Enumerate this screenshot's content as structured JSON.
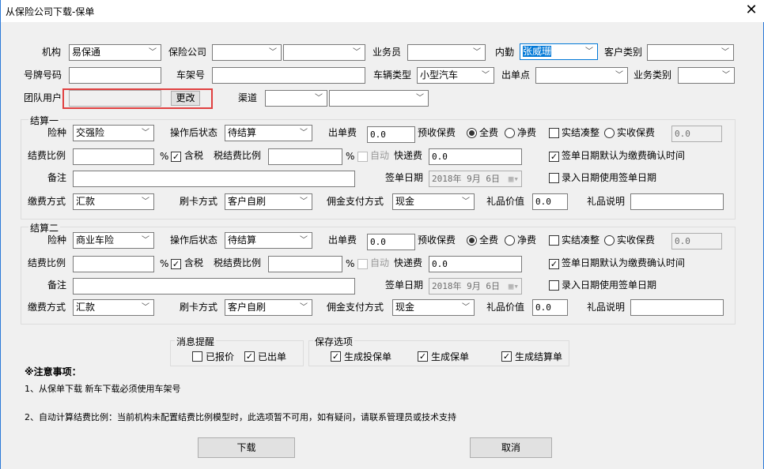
{
  "window": {
    "title": "从保险公司下载-保单",
    "close": "✕"
  },
  "top": {
    "org_label": "机构",
    "org_value": "易保通",
    "insurer_label": "保险公司",
    "insurer_value": "",
    "insurer_value2": "",
    "salesman_label": "业务员",
    "salesman_value": "",
    "internal_label": "内勤",
    "internal_value": "张威珊",
    "customer_type_label": "客户类别",
    "customer_type_value": "",
    "plate_label": "号牌号码",
    "plate_value": "",
    "vin_label": "车架号",
    "vin_value": "",
    "vehicle_type_label": "车辆类型",
    "vehicle_type_value": "小型汽车",
    "issue_point_label": "出单点",
    "issue_point_value": "",
    "business_type_label": "业务类别",
    "business_type_value": "",
    "team_user_label": "团队用户",
    "team_user_value": "",
    "change_button": "更改",
    "channel_label": "渠道",
    "channel_value": "",
    "channel_value2": ""
  },
  "settlements": [
    {
      "legend": "结算一",
      "insurance_label": "险种",
      "insurance_value": "交强险",
      "status_label": "操作后状态",
      "status_value": "待结算",
      "issue_fee_label": "出单费",
      "issue_fee_value": "0.0",
      "prepaid_label": "预收保费",
      "full_label": "全费",
      "net_label": "净费",
      "round_label": "实结凑整",
      "actual_label": "实收保费",
      "actual_value": "0.0",
      "ratio_label": "结费比例",
      "ratio_value": "",
      "percent": "%",
      "tax_label": "含税",
      "tax_ratio_label": "税结费比例",
      "tax_ratio_value": "",
      "auto_label": "自动",
      "express_label": "快递费",
      "express_value": "0.0",
      "default_sign_label": "签单日期默认为缴费确认时间",
      "remark_label": "备注",
      "remark_value": "",
      "sign_date_label": "签单日期",
      "sign_date_value": "2018年  9月  6日",
      "entry_date_label": "录入日期使用签单日期",
      "pay_method_label": "缴费方式",
      "pay_method_value": "汇款",
      "card_label": "刷卡方式",
      "card_value": "客户自刷",
      "commission_label": "佣金支付方式",
      "commission_value": "现金",
      "gift_value_label": "礼品价值",
      "gift_value": "0.0",
      "gift_desc_label": "礼品说明",
      "gift_desc_value": ""
    },
    {
      "legend": "结算二",
      "insurance_label": "险种",
      "insurance_value": "商业车险",
      "status_label": "操作后状态",
      "status_value": "待结算",
      "issue_fee_label": "出单费",
      "issue_fee_value": "0.0",
      "prepaid_label": "预收保费",
      "full_label": "全费",
      "net_label": "净费",
      "round_label": "实结凑整",
      "actual_label": "实收保费",
      "actual_value": "0.0",
      "ratio_label": "结费比例",
      "ratio_value": "",
      "percent": "%",
      "tax_label": "含税",
      "tax_ratio_label": "税结费比例",
      "tax_ratio_value": "",
      "auto_label": "自动",
      "express_label": "快递费",
      "express_value": "0.0",
      "default_sign_label": "签单日期默认为缴费确认时间",
      "remark_label": "备注",
      "remark_value": "",
      "sign_date_label": "签单日期",
      "sign_date_value": "2018年  9月  6日",
      "entry_date_label": "录入日期使用签单日期",
      "pay_method_label": "缴费方式",
      "pay_method_value": "汇款",
      "card_label": "刷卡方式",
      "card_value": "客户自刷",
      "commission_label": "佣金支付方式",
      "commission_value": "现金",
      "gift_value_label": "礼品价值",
      "gift_value": "0.0",
      "gift_desc_label": "礼品说明",
      "gift_desc_value": ""
    }
  ],
  "reminder": {
    "legend": "消息提醒",
    "quoted": "已报价",
    "issued": "已出单"
  },
  "save": {
    "legend": "保存选项",
    "proposal": "生成投保单",
    "policy": "生成保单",
    "settlement": "生成结算单"
  },
  "notes": {
    "title": "※注意事项：",
    "line1": "1、从保单下载 新车下载必须使用车架号",
    "line2": "2、自动计算结费比例：当前机构未配置结费比例模型时，此选项暂不可用，如有疑问，请联系管理员或技术支持"
  },
  "buttons": {
    "download": "下载",
    "cancel": "取消"
  }
}
